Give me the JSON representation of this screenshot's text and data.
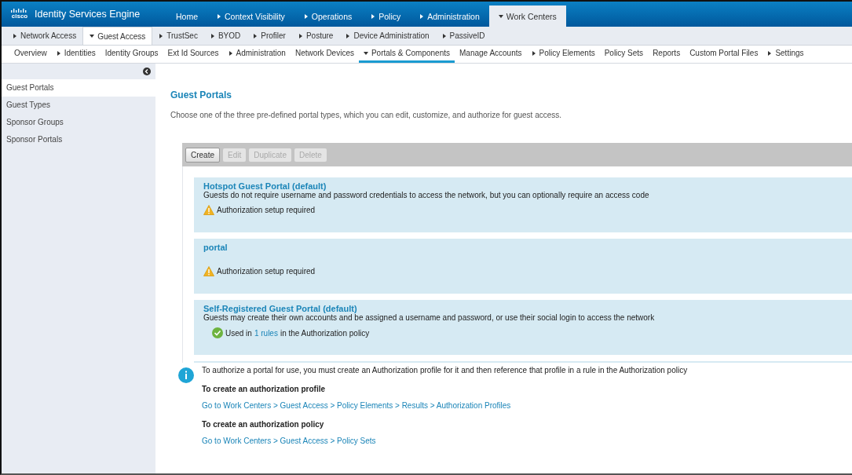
{
  "app": {
    "logo": "cisco",
    "title": "Identity Services Engine"
  },
  "top_tabs": [
    {
      "label": "Home",
      "dropdown": false,
      "selected": false
    },
    {
      "label": "Context Visibility",
      "dropdown": true,
      "selected": false
    },
    {
      "label": "Operations",
      "dropdown": true,
      "selected": false
    },
    {
      "label": "Policy",
      "dropdown": true,
      "selected": false
    },
    {
      "label": "Administration",
      "dropdown": true,
      "selected": false
    },
    {
      "label": "Work Centers",
      "dropdown": true,
      "selected": true
    }
  ],
  "second_tabs": [
    {
      "label": "Network Access",
      "dropdown": true,
      "selected": false
    },
    {
      "label": "Guest Access",
      "dropdown": true,
      "selected": true
    },
    {
      "label": "TrustSec",
      "dropdown": true,
      "selected": false
    },
    {
      "label": "BYOD",
      "dropdown": true,
      "selected": false
    },
    {
      "label": "Profiler",
      "dropdown": true,
      "selected": false
    },
    {
      "label": "Posture",
      "dropdown": true,
      "selected": false
    },
    {
      "label": "Device Administration",
      "dropdown": true,
      "selected": false
    },
    {
      "label": "PassiveID",
      "dropdown": true,
      "selected": false
    }
  ],
  "third_tabs": [
    {
      "label": "Overview",
      "dropdown": false,
      "selected": false
    },
    {
      "label": "Identities",
      "dropdown": true,
      "selected": false
    },
    {
      "label": "Identity Groups",
      "dropdown": false,
      "selected": false
    },
    {
      "label": "Ext Id Sources",
      "dropdown": false,
      "selected": false
    },
    {
      "label": "Administration",
      "dropdown": true,
      "selected": false
    },
    {
      "label": "Network Devices",
      "dropdown": false,
      "selected": false
    },
    {
      "label": "Portals & Components",
      "dropdown": true,
      "selected": true
    },
    {
      "label": "Manage Accounts",
      "dropdown": false,
      "selected": false
    },
    {
      "label": "Policy Elements",
      "dropdown": true,
      "selected": false
    },
    {
      "label": "Policy Sets",
      "dropdown": false,
      "selected": false
    },
    {
      "label": "Reports",
      "dropdown": false,
      "selected": false
    },
    {
      "label": "Custom Portal Files",
      "dropdown": false,
      "selected": false
    },
    {
      "label": "Settings",
      "dropdown": true,
      "selected": false
    }
  ],
  "sidebar": {
    "items": [
      {
        "label": "Guest Portals",
        "selected": true
      },
      {
        "label": "Guest Types",
        "selected": false
      },
      {
        "label": "Sponsor Groups",
        "selected": false
      },
      {
        "label": "Sponsor Portals",
        "selected": false
      }
    ]
  },
  "page": {
    "title": "Guest Portals",
    "description": "Choose one of the three pre-defined portal types, which you can edit, customize, and authorize for guest access."
  },
  "toolbar": [
    {
      "label": "Create",
      "disabled": false
    },
    {
      "label": "Edit",
      "disabled": true
    },
    {
      "label": "Duplicate",
      "disabled": true
    },
    {
      "label": "Delete",
      "disabled": true
    }
  ],
  "portals": [
    {
      "title": "Hotspot Guest Portal (default)",
      "description": "Guests do not require username and password credentials to access the network, but you can optionally require an access code",
      "status": {
        "kind": "warning",
        "text": "Authorization setup required"
      }
    },
    {
      "title": "portal",
      "status": {
        "kind": "warning",
        "text": "Authorization setup required"
      }
    },
    {
      "title": "Self-Registered Guest Portal (default)",
      "description": "Guests may create their own accounts and be assigned a username and password, or use their social login to access the network",
      "status": {
        "kind": "ok",
        "text": "Used in",
        "link": "1 rules",
        "suffix": "in the Authorization policy"
      }
    },
    {
      "kind": "hidden"
    }
  ],
  "info": {
    "text": "To authorize a portal for use, you must create an Authorization profile for it and then reference that profile in a rule in the Authorization policy",
    "sections": [
      {
        "heading": "To create an authorization profile",
        "link": "Go to Work Centers > Guest Access > Policy Elements > Results > Authorization Profiles"
      },
      {
        "heading": "To create an authorization policy",
        "link": "Go to Work Centers > Guest Access > Policy Sets"
      }
    ]
  }
}
